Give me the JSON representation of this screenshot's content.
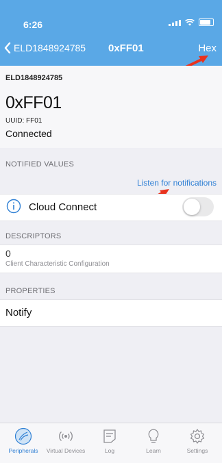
{
  "status_bar": {
    "time": "6:26"
  },
  "nav": {
    "back_label": "ELD1848924785",
    "title": "0xFF01",
    "right_action": "Hex"
  },
  "header": {
    "device_name": "ELD1848924785",
    "characteristic": "0xFF01",
    "uuid": "UUID: FF01",
    "status": "Connected"
  },
  "notified": {
    "section_label": "NOTIFIED VALUES",
    "listen_label": "Listen for notifications",
    "cloud_label": "Cloud Connect",
    "cloud_toggle_on": false
  },
  "descriptors": {
    "section_label": "DESCRIPTORS",
    "value": "0",
    "subtitle": "Client Characteristic Configuration"
  },
  "properties": {
    "section_label": "PROPERTIES",
    "value": "Notify"
  },
  "tabs": [
    {
      "label": "Peripherals",
      "icon": "peripherals-icon",
      "active": true
    },
    {
      "label": "Virtual Devices",
      "icon": "broadcast-icon",
      "active": false
    },
    {
      "label": "Log",
      "icon": "log-icon",
      "active": false
    },
    {
      "label": "Learn",
      "icon": "lightbulb-icon",
      "active": false
    },
    {
      "label": "Settings",
      "icon": "gear-icon",
      "active": false
    }
  ],
  "colors": {
    "header_blue": "#5aa8e6",
    "link_blue": "#2e7fd4",
    "annotation_red": "#e8321e"
  }
}
